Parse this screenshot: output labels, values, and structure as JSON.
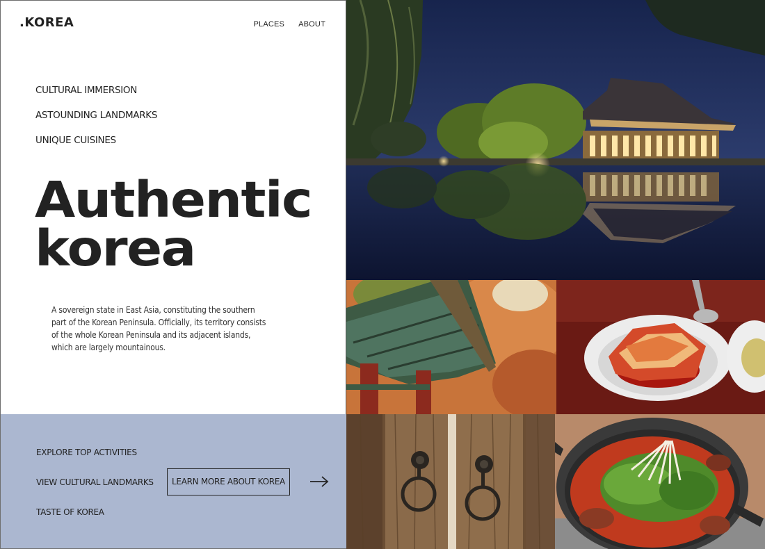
{
  "brand": {
    "logo": ".KOREA"
  },
  "nav": {
    "items": [
      "PLACES",
      "ABOUT"
    ]
  },
  "features": [
    "CULTURAL IMMERSION",
    "ASTOUNDING LANDMARKS",
    "UNIQUE CUISINES"
  ],
  "hero": {
    "line1": "Authentic",
    "line2": "korea",
    "description": "A sovereign state in East Asia, constituting the southern part of the Korean Peninsula. Officially, its territory consists of the whole Korean Peninsula and its adjacent islands, which are largely mountainous."
  },
  "bottom": {
    "links": [
      "EXPLORE TOP ACTIVITIES",
      "VIEW CULTURAL LANDMARKS",
      "TASTE OF KOREA"
    ],
    "cta": "LEARN MORE ABOUT KOREA",
    "arrow_icon": "arrow-right-icon"
  },
  "colors": {
    "panel": "#abb7d0",
    "text": "#222222",
    "background": "#ffffff"
  },
  "images": [
    "night-palace-reflection-photo",
    "temple-eaves-autumn-photo",
    "kimchi-dish-photo",
    "wooden-door-knockers-photo",
    "korean-stew-pot-photo"
  ]
}
